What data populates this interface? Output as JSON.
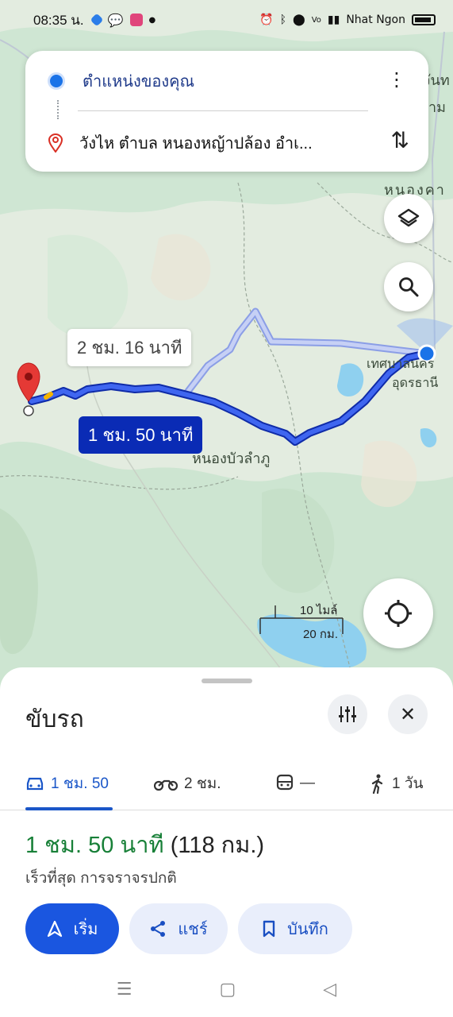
{
  "status_bar": {
    "time": "08:35 น.",
    "carrier": "Nhat Ngon",
    "icons": [
      "messenger-icon",
      "chat-icon",
      "app-icon",
      "alarm-icon",
      "bluetooth-icon",
      "location-icon",
      "volte-icon",
      "signal-icon",
      "battery-icon"
    ]
  },
  "route_card": {
    "origin": "ตำแหน่งของคุณ",
    "destination": "วังไห ตำบล หนองหญ้าปล้อง อำเ...",
    "more_icon": "more-vert-icon",
    "swap_icon": "swap-icon"
  },
  "map": {
    "labels": {
      "top_right": "จันท",
      "top_right2": "าม",
      "nong_ka": "หนองคา",
      "city": "เทศบาลนคร",
      "city2": "อุดรธานี",
      "town": "หนองบัวลำภู"
    },
    "alt_route_time": "2 ชม. 16 นาที",
    "main_route_time": "1 ชม. 50 นาที",
    "scale_miles": "10 ไมล์",
    "scale_km": "20 กม.",
    "colors": {
      "route_main": "#2146d9",
      "route_alt": "#a9b9ef",
      "water": "#8fd0ef",
      "land": "#e8efe6"
    }
  },
  "sheet": {
    "title": "ขับรถ",
    "tabs": [
      {
        "icon": "car-icon",
        "label": "1 ชม. 50"
      },
      {
        "icon": "motorcycle-icon",
        "label": "2 ชม."
      },
      {
        "icon": "transit-icon",
        "label": "—"
      },
      {
        "icon": "walk-icon",
        "label": "1 วัน"
      }
    ],
    "duration": "1 ชม. 50 นาที",
    "distance": "(118 กม.)",
    "subtitle": "เร็วที่สุด การจราจรปกติ",
    "buttons": {
      "start": "เริ่ม",
      "share": "แชร์",
      "save": "บันทึก"
    }
  }
}
